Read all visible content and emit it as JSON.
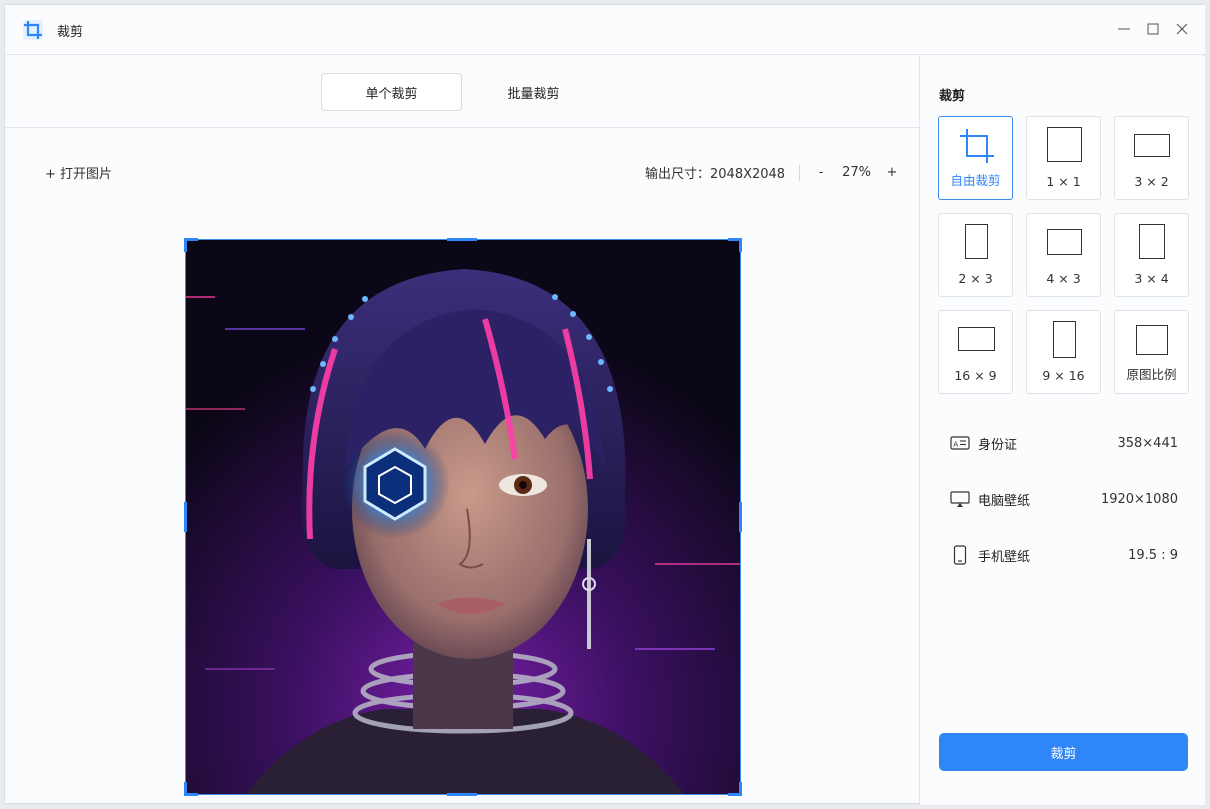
{
  "window": {
    "title": "裁剪",
    "icon": "crop-icon",
    "controls": [
      "minimize-icon",
      "maximize-icon",
      "close-icon"
    ]
  },
  "tabs": [
    {
      "label": "单个裁剪",
      "active": true
    },
    {
      "label": "批量裁剪",
      "active": false
    }
  ],
  "toolbar": {
    "open_label": "+ 打开图片",
    "output_label": "输出尺寸：2048X2048",
    "zoom_out": "-",
    "zoom_value": "27%",
    "zoom_in": "+"
  },
  "panel": {
    "title": "裁剪",
    "ratios": [
      {
        "label": "自由裁剪",
        "icon": "crop-icon",
        "active": true
      },
      {
        "label": "1 × 1"
      },
      {
        "label": "3 × 2"
      },
      {
        "label": "2 × 3"
      },
      {
        "label": "4 × 3"
      },
      {
        "label": "3 × 4"
      },
      {
        "label": "16 × 9"
      },
      {
        "label": "9 × 16"
      },
      {
        "label": "原图比例"
      }
    ],
    "presets": [
      {
        "label": "身份证",
        "value": "358×441",
        "icon": "id-card-icon"
      },
      {
        "label": "电脑壁纸",
        "value": "1920×1080",
        "icon": "monitor-icon"
      },
      {
        "label": "手机壁纸",
        "value": "19.5 : 9",
        "icon": "phone-icon"
      }
    ],
    "button_label": "裁剪"
  },
  "colors": {
    "accent": "#2f86f6",
    "background": "#fbfcfd",
    "border": "#dfe2e7"
  }
}
